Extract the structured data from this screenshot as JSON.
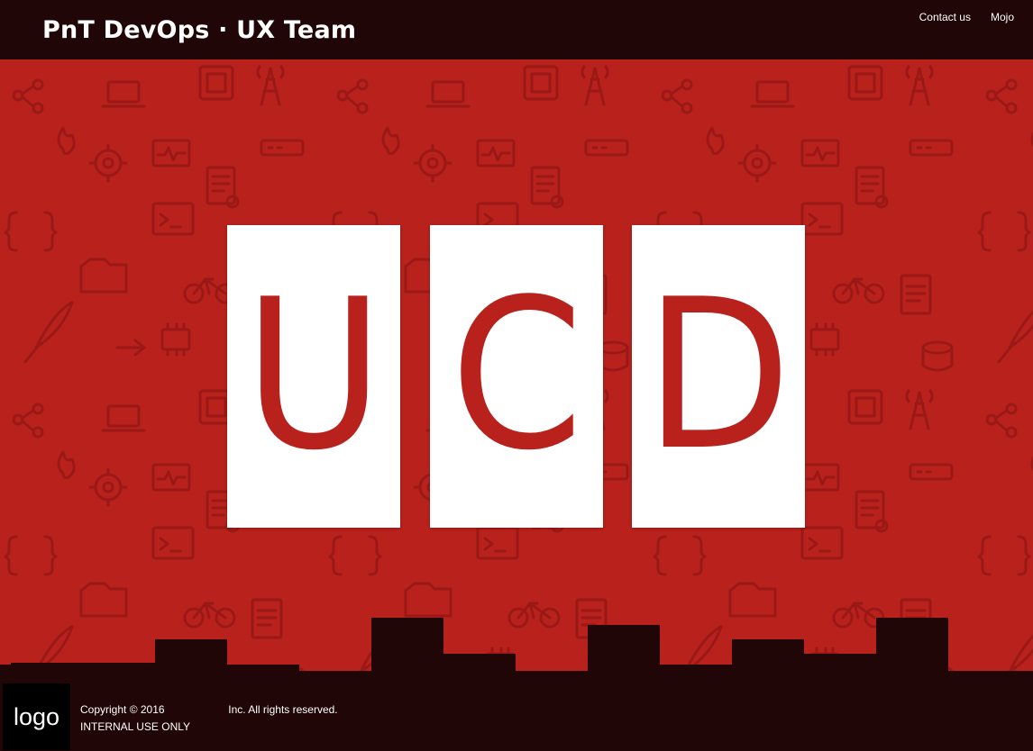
{
  "header": {
    "title": "PnT DevOps · UX Team",
    "nav": [
      "Contact us",
      "Mojo"
    ]
  },
  "hero": {
    "letters": [
      "U",
      "C",
      "D"
    ]
  },
  "footer": {
    "logo_text": "logo",
    "copyright_prefix": "Copyright © 2016",
    "copyright_suffix": "Inc. All rights reserved.",
    "internal_note": "INTERNAL USE ONLY"
  },
  "colors": {
    "header_bg": "#200606",
    "hero_bg": "#b8211c",
    "tile_bg": "#ffffff",
    "accent": "#b8211c"
  },
  "icons": [
    "cell-tower-icon",
    "chip-icon",
    "bicycle-icon",
    "folder-icon",
    "terminal-icon",
    "certificate-icon",
    "gear-icon",
    "network-icon",
    "flame-icon",
    "laptop-icon",
    "feather-icon",
    "document-icon"
  ]
}
